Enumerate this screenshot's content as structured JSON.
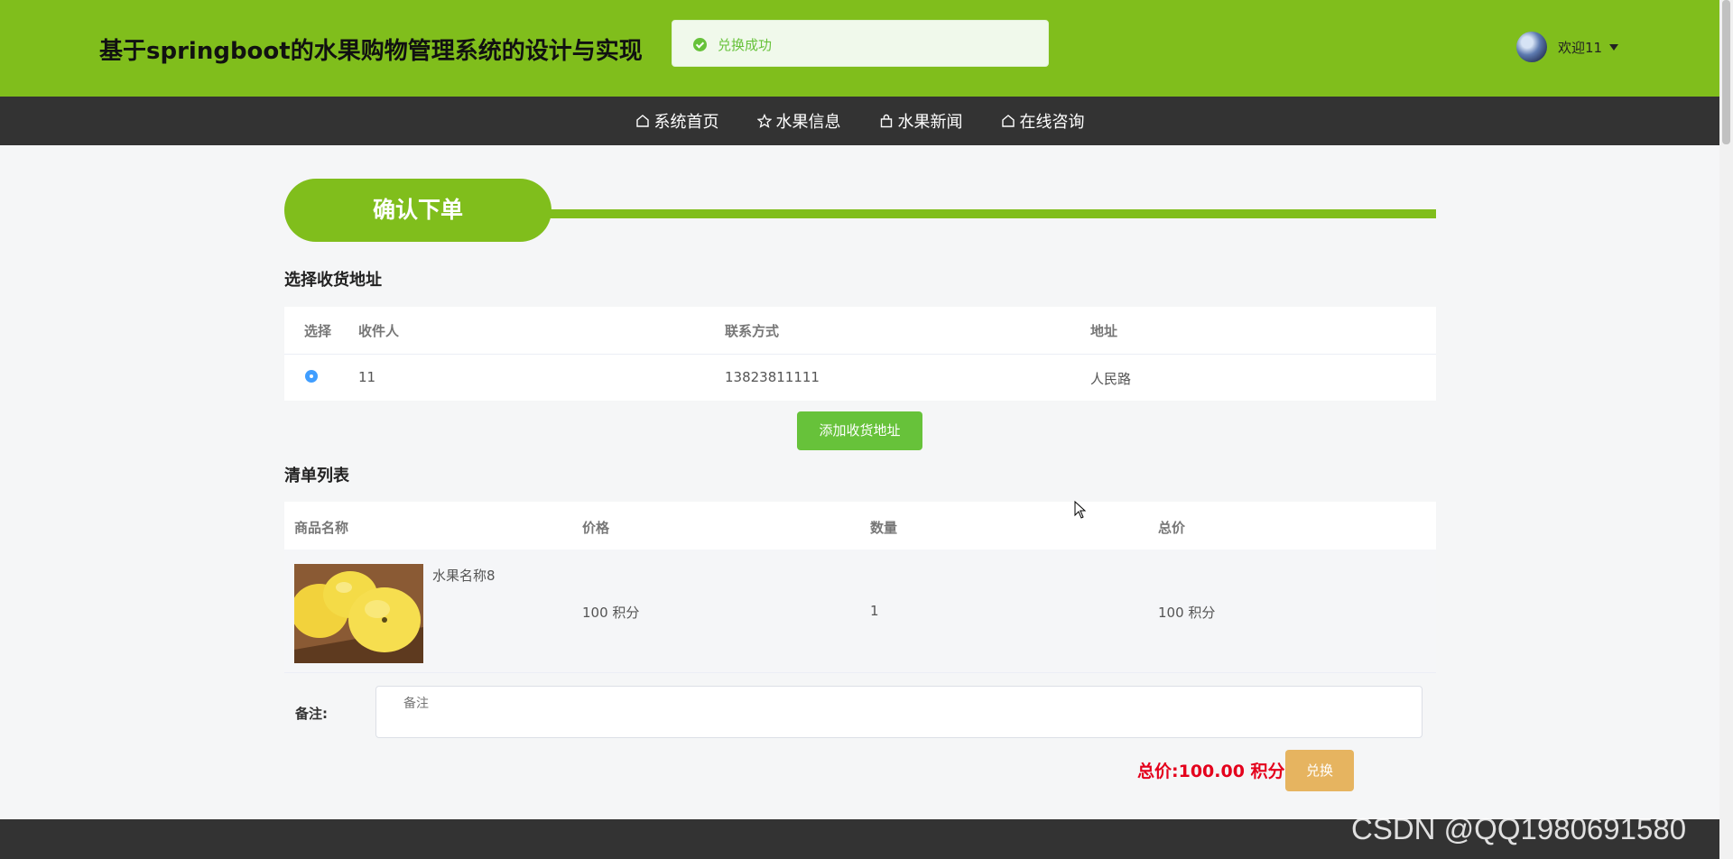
{
  "header": {
    "title": "基于springboot的水果购物管理系统的设计与实现",
    "brand_color": "#80be1c",
    "user": {
      "welcome": "欢迎11"
    }
  },
  "toast": {
    "text": "兑换成功",
    "type": "success"
  },
  "nav": {
    "items": [
      {
        "label": "系统首页",
        "icon": "home-icon"
      },
      {
        "label": "水果信息",
        "icon": "star-icon"
      },
      {
        "label": "水果新闻",
        "icon": "bag-icon"
      },
      {
        "label": "在线咨询",
        "icon": "home-icon"
      }
    ]
  },
  "page": {
    "section_title": "确认下单",
    "address_heading": "选择收货地址",
    "address_table": {
      "headers": [
        "选择",
        "收件人",
        "联系方式",
        "地址"
      ],
      "rows": [
        {
          "selected": true,
          "name": "11",
          "phone": "13823811111",
          "address": "人民路"
        }
      ]
    },
    "add_address_button": "添加收货地址",
    "list_heading": "清单列表",
    "list_table": {
      "headers": [
        "商品名称",
        "价格",
        "数量",
        "总价"
      ],
      "rows": [
        {
          "name": "水果名称8",
          "price": "100 积分",
          "quantity": "1",
          "total": "100 积分"
        }
      ]
    },
    "remark": {
      "label": "备注:",
      "placeholder": "备注"
    },
    "total_text": "总价:100.00 积分",
    "exchange_button": "兑换"
  },
  "watermark": "CSDN @QQ1980691580"
}
